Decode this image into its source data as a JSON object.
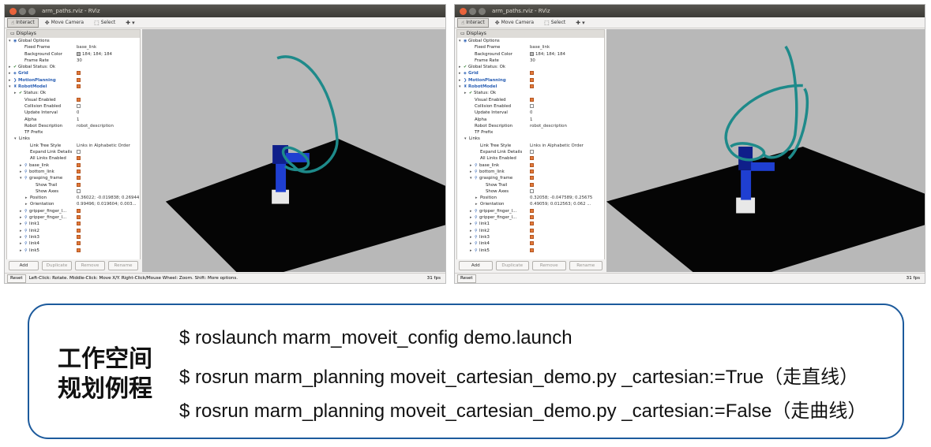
{
  "window_left": {
    "title": "arm_paths.rviz - RViz",
    "toolbar": [
      {
        "label": "Interact",
        "icon": "interact-icon",
        "active": true
      },
      {
        "label": "Move Camera",
        "icon": "move-camera-icon",
        "active": false
      },
      {
        "label": "Select",
        "icon": "select-icon",
        "active": false
      }
    ],
    "panel_title": "Displays",
    "tree": [
      {
        "label": "Global Options",
        "value": "",
        "arrow": "▾",
        "icon": "globe-icon",
        "indent": 0
      },
      {
        "label": "Fixed Frame",
        "value": "base_link",
        "indent": 2
      },
      {
        "label": "Background Color",
        "value": "184; 184; 184",
        "indent": 2,
        "swatch": true
      },
      {
        "label": "Frame Rate",
        "value": "30",
        "indent": 2
      },
      {
        "label": "Global Status: Ok",
        "value": "",
        "arrow": "▸",
        "icon": "check-icon",
        "indent": 0
      },
      {
        "label": "Grid",
        "value": "",
        "arrow": "▸",
        "icon": "grid-icon",
        "indent": 0,
        "blue": true,
        "check": true
      },
      {
        "label": "MotionPlanning",
        "value": "",
        "arrow": "▸",
        "icon": "motion-planning-icon",
        "indent": 0,
        "blue": true,
        "check": true
      },
      {
        "label": "RobotModel",
        "value": "",
        "arrow": "▾",
        "icon": "robot-icon",
        "indent": 0,
        "blue": true,
        "check": true
      },
      {
        "label": "Status: Ok",
        "value": "",
        "arrow": "▸",
        "icon": "check-icon",
        "indent": 1
      },
      {
        "label": "Visual Enabled",
        "value": "",
        "indent": 2,
        "check": true
      },
      {
        "label": "Collision Enabled",
        "value": "",
        "indent": 2,
        "check": false
      },
      {
        "label": "Update Interval",
        "value": "0",
        "indent": 2
      },
      {
        "label": "Alpha",
        "value": "1",
        "indent": 2
      },
      {
        "label": "Robot Description",
        "value": "robot_description",
        "indent": 2
      },
      {
        "label": "TF Prefix",
        "value": "",
        "indent": 2
      },
      {
        "label": "Links",
        "value": "",
        "arrow": "▾",
        "indent": 1
      },
      {
        "label": "Link Tree Style",
        "value": "Links in Alphabetic Order",
        "indent": 3
      },
      {
        "label": "Expand Link Details",
        "value": "",
        "indent": 3,
        "check": false
      },
      {
        "label": "All Links Enabled",
        "value": "",
        "indent": 3,
        "check": true
      },
      {
        "label": "base_link",
        "value": "",
        "arrow": "▸",
        "icon": "link-icon",
        "indent": 2,
        "check": true
      },
      {
        "label": "bottom_link",
        "value": "",
        "arrow": "▸",
        "icon": "link-icon",
        "indent": 2,
        "check": true
      },
      {
        "label": "grasping_frame",
        "value": "",
        "arrow": "▾",
        "icon": "link-icon",
        "indent": 2,
        "check": true
      },
      {
        "label": "Show Trail",
        "value": "",
        "indent": 4,
        "check": true
      },
      {
        "label": "Show Axes",
        "value": "",
        "indent": 4,
        "check": false
      },
      {
        "label": "Position",
        "value": "0.36022; -0.019838; 0.26944",
        "arrow": "▸",
        "indent": 3
      },
      {
        "label": "Orientation",
        "value": "0.99496; 0.019604; 0.003...",
        "arrow": "▸",
        "indent": 3
      },
      {
        "label": "gripper_finger_l...",
        "value": "",
        "arrow": "▸",
        "icon": "link-icon",
        "indent": 2,
        "check": true
      },
      {
        "label": "gripper_finger_l...",
        "value": "",
        "arrow": "▸",
        "icon": "link-icon",
        "indent": 2,
        "check": true
      },
      {
        "label": "link1",
        "value": "",
        "arrow": "▸",
        "icon": "link-icon",
        "indent": 2,
        "check": true
      },
      {
        "label": "link2",
        "value": "",
        "arrow": "▸",
        "icon": "link-icon",
        "indent": 2,
        "check": true
      },
      {
        "label": "link3",
        "value": "",
        "arrow": "▸",
        "icon": "link-icon",
        "indent": 2,
        "check": true
      },
      {
        "label": "link4",
        "value": "",
        "arrow": "▸",
        "icon": "link-icon",
        "indent": 2,
        "check": true
      },
      {
        "label": "link5",
        "value": "",
        "arrow": "▸",
        "icon": "link-icon",
        "indent": 2,
        "check": true
      }
    ],
    "buttons": [
      {
        "label": "Add",
        "enabled": true
      },
      {
        "label": "Duplicate",
        "enabled": false
      },
      {
        "label": "Remove",
        "enabled": false
      },
      {
        "label": "Rename",
        "enabled": false
      }
    ],
    "reset_label": "Reset",
    "status_text": "Left-Click: Rotate. Middle-Click: Move X/Y. Right-Click/Mouse Wheel: Zoom. Shift: More options.",
    "fps": "31 fps"
  },
  "window_right": {
    "title": "arm_paths.rviz - RViz",
    "toolbar": [
      {
        "label": "Interact",
        "icon": "interact-icon",
        "active": true
      },
      {
        "label": "Move Camera",
        "icon": "move-camera-icon",
        "active": false
      },
      {
        "label": "Select",
        "icon": "select-icon",
        "active": false
      }
    ],
    "panel_title": "Displays",
    "tree": [
      {
        "label": "Global Options",
        "value": "",
        "arrow": "▾",
        "icon": "globe-icon",
        "indent": 0
      },
      {
        "label": "Fixed Frame",
        "value": "base_link",
        "indent": 2
      },
      {
        "label": "Background Color",
        "value": "184; 184; 184",
        "indent": 2,
        "swatch": true
      },
      {
        "label": "Frame Rate",
        "value": "30",
        "indent": 2
      },
      {
        "label": "Global Status: Ok",
        "value": "",
        "arrow": "▸",
        "icon": "check-icon",
        "indent": 0
      },
      {
        "label": "Grid",
        "value": "",
        "arrow": "▸",
        "icon": "grid-icon",
        "indent": 0,
        "blue": true,
        "check": true
      },
      {
        "label": "MotionPlanning",
        "value": "",
        "arrow": "▸",
        "icon": "motion-planning-icon",
        "indent": 0,
        "blue": true,
        "check": true
      },
      {
        "label": "RobotModel",
        "value": "",
        "arrow": "▾",
        "icon": "robot-icon",
        "indent": 0,
        "blue": true,
        "check": true
      },
      {
        "label": "Status: Ok",
        "value": "",
        "arrow": "▸",
        "icon": "check-icon",
        "indent": 1
      },
      {
        "label": "Visual Enabled",
        "value": "",
        "indent": 2,
        "check": true
      },
      {
        "label": "Collision Enabled",
        "value": "",
        "indent": 2,
        "check": false
      },
      {
        "label": "Update Interval",
        "value": "0",
        "indent": 2
      },
      {
        "label": "Alpha",
        "value": "1",
        "indent": 2
      },
      {
        "label": "Robot Description",
        "value": "robot_description",
        "indent": 2
      },
      {
        "label": "TF Prefix",
        "value": "",
        "indent": 2
      },
      {
        "label": "Links",
        "value": "",
        "arrow": "▾",
        "indent": 1
      },
      {
        "label": "Link Tree Style",
        "value": "Links in Alphabetic Order",
        "indent": 3
      },
      {
        "label": "Expand Link Details",
        "value": "",
        "indent": 3,
        "check": false
      },
      {
        "label": "All Links Enabled",
        "value": "",
        "indent": 3,
        "check": true
      },
      {
        "label": "base_link",
        "value": "",
        "arrow": "▸",
        "icon": "link-icon",
        "indent": 2,
        "check": true
      },
      {
        "label": "bottom_link",
        "value": "",
        "arrow": "▸",
        "icon": "link-icon",
        "indent": 2,
        "check": true
      },
      {
        "label": "grasping_frame",
        "value": "",
        "arrow": "▾",
        "icon": "link-icon",
        "indent": 2,
        "check": true
      },
      {
        "label": "Show Trail",
        "value": "",
        "indent": 4,
        "check": true
      },
      {
        "label": "Show Axes",
        "value": "",
        "indent": 4,
        "check": false
      },
      {
        "label": "Position",
        "value": "0.32058; -0.047589; 0.25675",
        "arrow": "▸",
        "indent": 3
      },
      {
        "label": "Orientation",
        "value": "0.49059; 0.012563; 0.062 ...",
        "arrow": "▸",
        "indent": 3
      },
      {
        "label": "gripper_finger_l...",
        "value": "",
        "arrow": "▸",
        "icon": "link-icon",
        "indent": 2,
        "check": true
      },
      {
        "label": "gripper_finger_l...",
        "value": "",
        "arrow": "▸",
        "icon": "link-icon",
        "indent": 2,
        "check": true
      },
      {
        "label": "link1",
        "value": "",
        "arrow": "▸",
        "icon": "link-icon",
        "indent": 2,
        "check": true
      },
      {
        "label": "link2",
        "value": "",
        "arrow": "▸",
        "icon": "link-icon",
        "indent": 2,
        "check": true
      },
      {
        "label": "link3",
        "value": "",
        "arrow": "▸",
        "icon": "link-icon",
        "indent": 2,
        "check": true
      },
      {
        "label": "link4",
        "value": "",
        "arrow": "▸",
        "icon": "link-icon",
        "indent": 2,
        "check": true
      },
      {
        "label": "link5",
        "value": "",
        "arrow": "▸",
        "icon": "link-icon",
        "indent": 2,
        "check": true
      }
    ],
    "buttons": [
      {
        "label": "Add",
        "enabled": true
      },
      {
        "label": "Duplicate",
        "enabled": false
      },
      {
        "label": "Remove",
        "enabled": false
      },
      {
        "label": "Rename",
        "enabled": false
      }
    ],
    "reset_label": "Reset",
    "status_text": "",
    "fps": "31 fps"
  },
  "commands": {
    "title": "工作空间\n规划例程",
    "lines": [
      "$ roslaunch marm_moveit_config demo.launch",
      "$ rosrun marm_planning moveit_cartesian_demo.py _cartesian:=True（走直线）",
      "$ rosrun marm_planning moveit_cartesian_demo.py _cartesian:=False（走曲线）"
    ]
  },
  "colors": {
    "viewport_bg": "#b8b8b8",
    "trail": "#1e8a8a",
    "robot_blue": "#1f3fd1",
    "box_border": "#1c5a9c",
    "checkbox_on": "#e37a3a"
  }
}
